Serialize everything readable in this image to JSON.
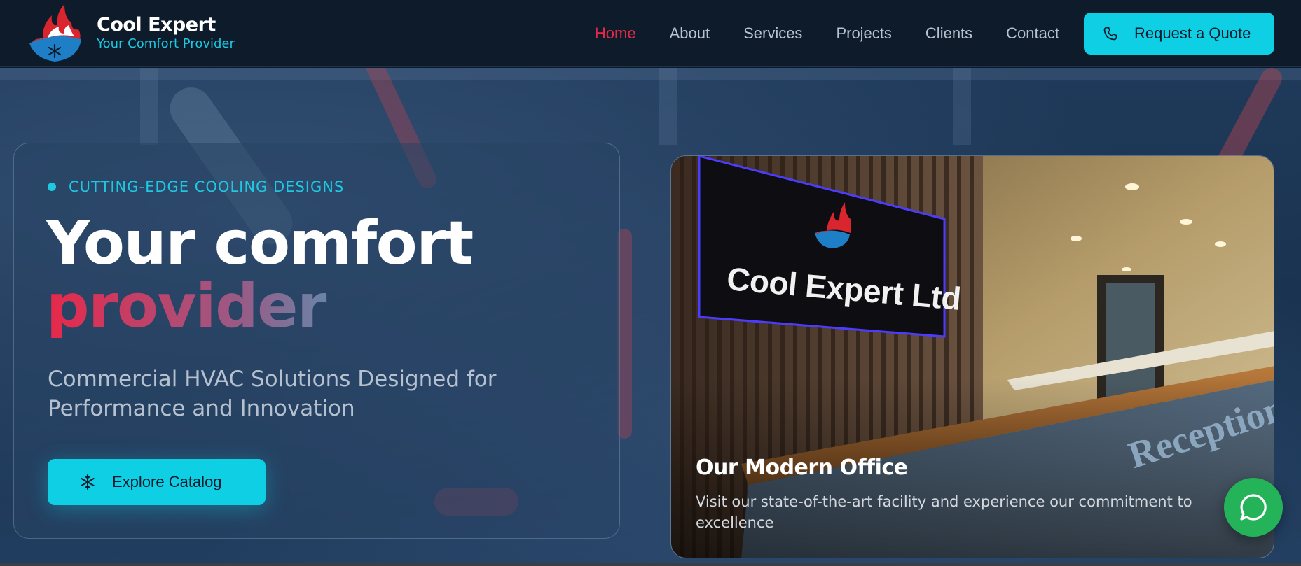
{
  "brand": {
    "name": "Cool Expert",
    "tagline": "Your Comfort Provider",
    "logo_icon": "flame-snowflake-logo"
  },
  "nav": {
    "items": [
      {
        "label": "Home",
        "active": true
      },
      {
        "label": "About",
        "active": false
      },
      {
        "label": "Services",
        "active": false
      },
      {
        "label": "Projects",
        "active": false
      },
      {
        "label": "Clients",
        "active": false
      },
      {
        "label": "Contact",
        "active": false
      }
    ],
    "cta": {
      "label": "Request a Quote",
      "icon": "phone-icon"
    }
  },
  "hero": {
    "eyebrow": "CUTTING-EDGE COOLING DESIGNS",
    "title_line1": "Your comfort",
    "title_line2": "provider",
    "subtitle": "Commercial HVAC Solutions Designed for Performance and Innovation",
    "button": {
      "label": "Explore Catalog",
      "icon": "snowflake-icon"
    }
  },
  "office": {
    "title": "Our Modern Office",
    "description": "Visit our state-of-the-art facility and experience our commitment to excellence",
    "sign_text": "Cool Expert Ltd",
    "wall_text": "Reception"
  },
  "chat": {
    "icon": "whatsapp-chat-icon"
  },
  "colors": {
    "accent_cyan": "#0fcfe4",
    "accent_red": "#e8284a",
    "nav_bg": "#0d1b2a",
    "chat_green": "#25b35a"
  }
}
